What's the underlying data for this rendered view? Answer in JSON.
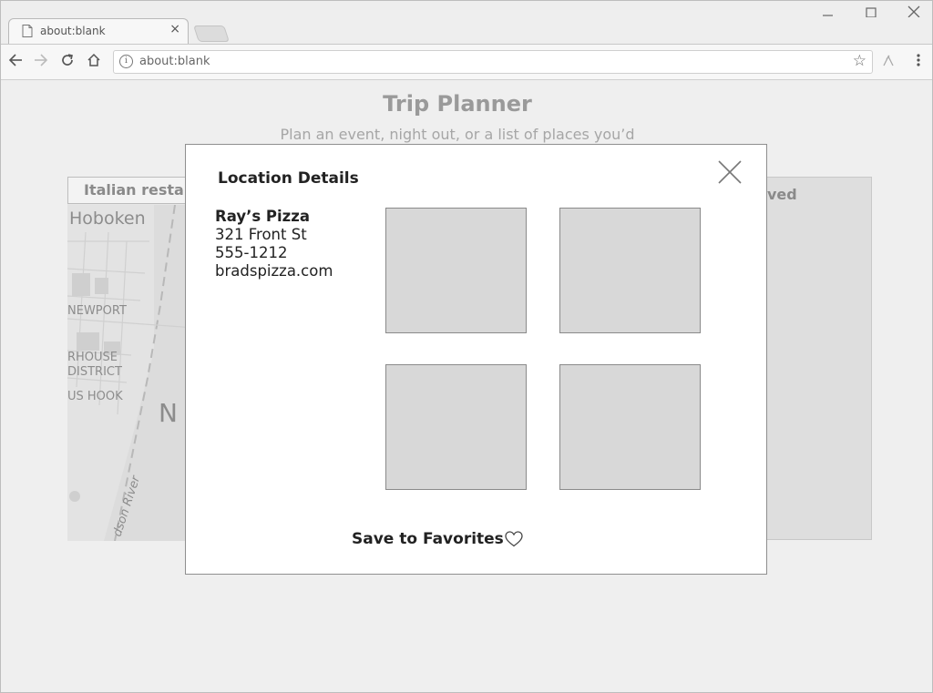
{
  "browser": {
    "tab_title": "about:blank",
    "tab_close": "×",
    "url": "about:blank",
    "icons": [
      "page-icon",
      "close-icon",
      "minimize-icon",
      "maximize-icon",
      "back-icon",
      "forward-icon",
      "reload-icon",
      "home-icon",
      "info-icon",
      "star-icon",
      "extension-icon",
      "menu-icon"
    ]
  },
  "page": {
    "title": "Trip Planner",
    "subtitle": "Plan an event, night out, or a list of places you’d",
    "search_value": "Italian restau",
    "map_labels": [
      "Hoboken",
      "NEWPORT",
      "RHOUSE",
      "DISTRICT",
      "US HOOK",
      "N",
      "dson River"
    ],
    "right_panel_label": "ved"
  },
  "modal": {
    "title": "Location Details",
    "place": {
      "name": "Ray’s Pizza",
      "address": "321 Front St",
      "phone": "555-1212",
      "website": "bradspizza.com"
    },
    "save_label": "Save to Favorites"
  },
  "colors": {
    "modal_border": "#8f8f8f",
    "photo_placeholder": "#d8d8d8",
    "background_dim": "#efefef"
  }
}
